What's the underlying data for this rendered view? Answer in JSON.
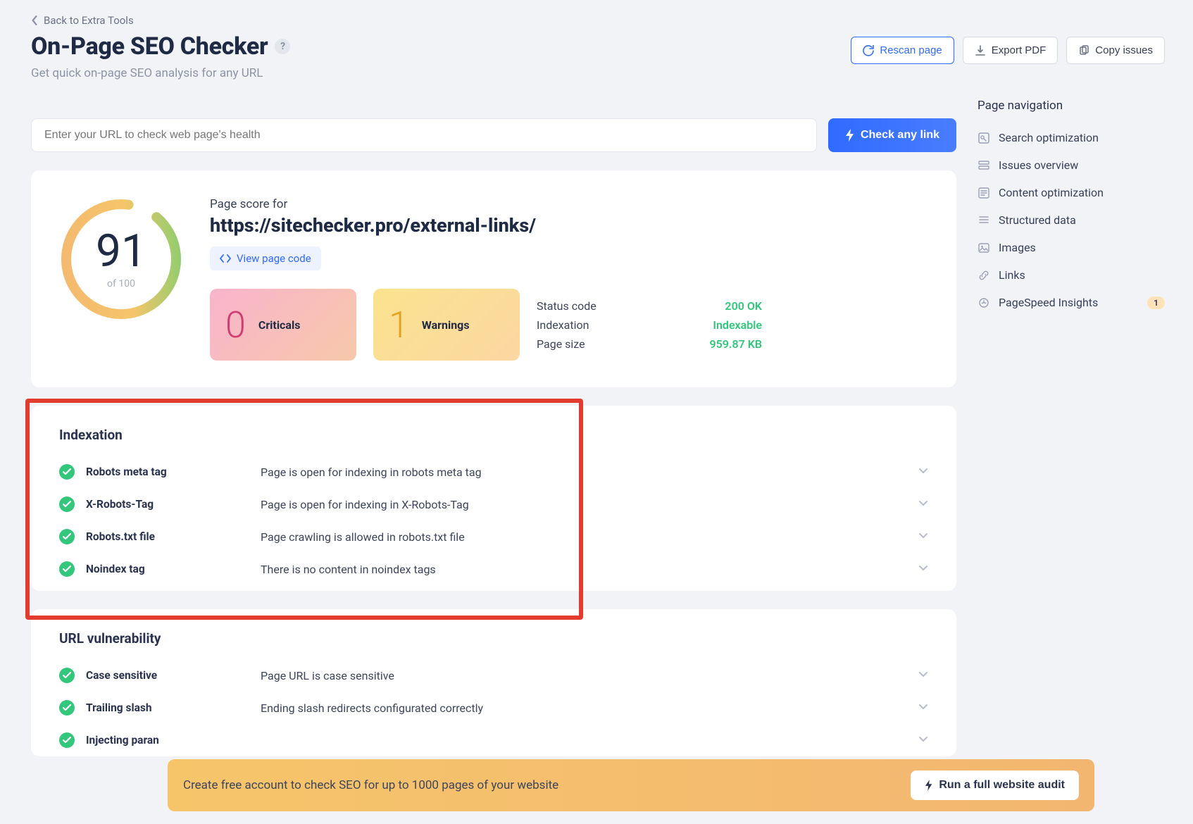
{
  "back_link": "Back to Extra Tools",
  "title": "On-Page SEO Checker",
  "subtitle": "Get quick on-page SEO analysis for any URL",
  "actions": {
    "rescan": "Rescan page",
    "export_pdf": "Export PDF",
    "copy_issues": "Copy issues"
  },
  "url_input_placeholder": "Enter your URL to check web page's health",
  "check_button": "Check any link",
  "score": {
    "value": "91",
    "of": "of 100"
  },
  "score_label": "Page score for",
  "score_url": "https://sitechecker.pro/external-links/",
  "view_page_code": "View page code",
  "criticals": {
    "num": "0",
    "label": "Criticals"
  },
  "warnings": {
    "num": "1",
    "label": "Warnings"
  },
  "status": {
    "status_code_k": "Status code",
    "status_code_v": "200 OK",
    "indexation_k": "Indexation",
    "indexation_v": "Indexable",
    "page_size_k": "Page size",
    "page_size_v": "959.87 KB"
  },
  "indexation": {
    "title": "Indexation",
    "rows": [
      {
        "label": "Robots meta tag",
        "desc": "Page is open for indexing in robots meta tag"
      },
      {
        "label": "X-Robots-Tag",
        "desc": "Page is open for indexing in X-Robots-Tag"
      },
      {
        "label": "Robots.txt file",
        "desc": "Page crawling is allowed in robots.txt file"
      },
      {
        "label": "Noindex tag",
        "desc": "There is no content in noindex tags"
      }
    ]
  },
  "url_vuln": {
    "title": "URL vulnerability",
    "rows": [
      {
        "label": "Case sensitive",
        "desc": "Page URL is case sensitive"
      },
      {
        "label": "Trailing slash",
        "desc": "Ending slash redirects configurated correctly"
      },
      {
        "label": "Injecting paran",
        "desc": ""
      }
    ]
  },
  "nav": {
    "title": "Page navigation",
    "items": [
      {
        "label": "Search optimization"
      },
      {
        "label": "Issues overview"
      },
      {
        "label": "Content optimization"
      },
      {
        "label": "Structured data"
      },
      {
        "label": "Images"
      },
      {
        "label": "Links"
      },
      {
        "label": "PageSpeed Insights",
        "badge": "1"
      }
    ]
  },
  "cta": {
    "text": "Create free account to check SEO for up to 1000 pages of your website",
    "button": "Run a full website audit"
  }
}
